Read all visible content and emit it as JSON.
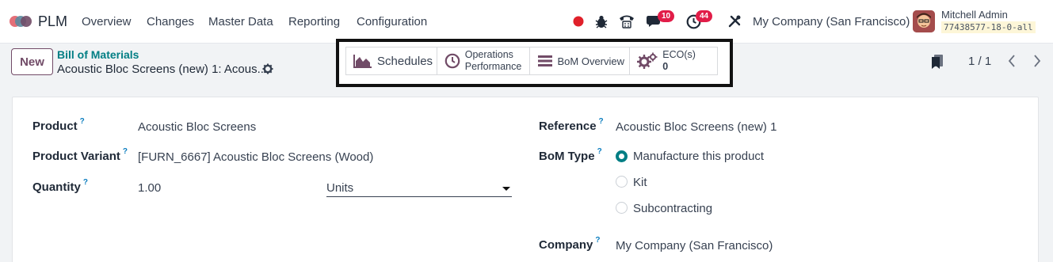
{
  "navbar": {
    "app_name": "PLM",
    "menu": [
      "Overview",
      "Changes",
      "Master Data",
      "Reporting",
      "Configuration"
    ],
    "messages_count": "10",
    "activities_count": "44",
    "company": "My Company (San Francisco)",
    "user_name": "Mitchell Admin",
    "database": "77438577-18-0-all"
  },
  "control": {
    "new_label": "New",
    "breadcrumb_parent": "Bill of Materials",
    "breadcrumb_current": "Acoustic Bloc Screens (new) 1: Acous...",
    "smart_buttons": {
      "schedules": "Schedules",
      "operations_line1": "Operations",
      "operations_line2": "Performance",
      "bom_overview": "BoM Overview",
      "eco_label": "ECO(s)",
      "eco_count": "0"
    },
    "pager": "1 / 1"
  },
  "form": {
    "product_label": "Product",
    "product_value": "Acoustic Bloc Screens",
    "variant_label": "Product Variant",
    "variant_value": "[FURN_6667] Acoustic Bloc Screens (Wood)",
    "quantity_label": "Quantity",
    "quantity_value": "1.00",
    "uom_value": "Units",
    "reference_label": "Reference",
    "reference_value": "Acoustic Bloc Screens (new) 1",
    "bom_type_label": "BoM Type",
    "bom_type_options": [
      "Manufacture this product",
      "Kit",
      "Subcontracting"
    ],
    "bom_type_selected": "Manufacture this product",
    "company_label": "Company",
    "company_value": "My Company (San Francisco)",
    "help_marker": "?"
  },
  "colors": {
    "brand": "#714b67",
    "teal": "#017e84",
    "badge": "#e11d48",
    "recording_dot": "#e0202a"
  },
  "icons": [
    "odoo-logo-icon",
    "record-dot-icon",
    "bug-icon",
    "phone-icon",
    "chat-icon",
    "clock-icon",
    "tools-icon",
    "gear-icon",
    "area-chart-icon",
    "clock-icon",
    "bars-icon",
    "cogs-icon",
    "bookmark-icon",
    "chevron-left-icon",
    "chevron-right-icon"
  ]
}
